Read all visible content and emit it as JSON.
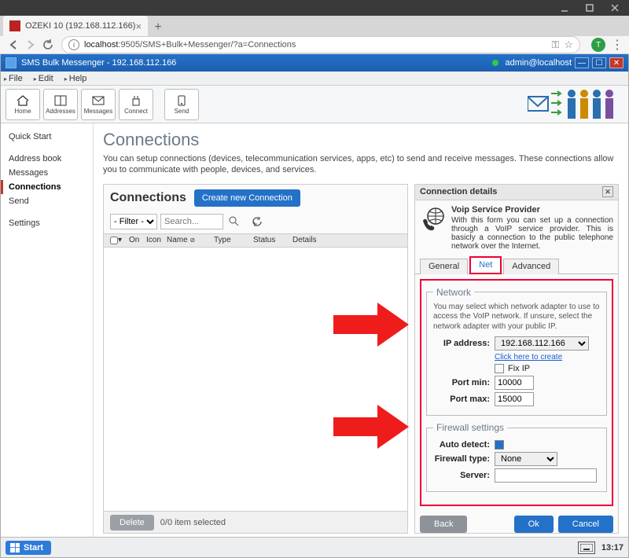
{
  "browser": {
    "tab_title": "OZEKI 10 (192.168.112.166)",
    "url_host": "localhost",
    "url_path": ":9505/SMS+Bulk+Messenger/?a=Connections",
    "avatar_letter": "T"
  },
  "app_bar": {
    "title": "SMS Bulk Messenger - 192.168.112.166",
    "user": "admin@localhost"
  },
  "menu": {
    "file": "File",
    "edit": "Edit",
    "help": "Help"
  },
  "toolbar": {
    "home": "Home",
    "addresses": "Addresses",
    "messages": "Messages",
    "connect": "Connect",
    "send": "Send"
  },
  "sidebar": {
    "quick_start": "Quick Start",
    "address_book": "Address book",
    "messages": "Messages",
    "connections": "Connections",
    "send": "Send",
    "settings": "Settings"
  },
  "main": {
    "heading": "Connections",
    "description": "You can setup connections (devices, telecommunication services, apps, etc) to send and receive messages. These connections allow you to communicate with people, devices, and services."
  },
  "conn_panel": {
    "title": "Connections",
    "create_btn": "Create new Connection",
    "filter_option": "- Filter -",
    "search_placeholder": "Search...",
    "cols": {
      "on": "On",
      "icon": "Icon",
      "name": "Name",
      "type": "Type",
      "status": "Status",
      "details": "Details"
    },
    "delete_btn": "Delete",
    "foot_status": "0/0 item selected"
  },
  "details": {
    "title": "Connection details",
    "provider_name": "Voip Service Provider",
    "provider_desc": "With this form you can set up a connection through a VoIP service provider. This is basicly a connection to the public telephone network over the Internet.",
    "tabs": {
      "general": "General",
      "net": "Net",
      "advanced": "Advanced"
    },
    "network": {
      "legend": "Network",
      "desc": "You may select which network adapter to use to access the VoIP network. If unsure, select the network adapter with your public IP.",
      "ip_label": "IP address:",
      "ip_value": "192.168.112.166",
      "create_link": "Click here to create",
      "fix_ip": "Fix IP",
      "port_min_label": "Port min:",
      "port_min_value": "10000",
      "port_max_label": "Port max:",
      "port_max_value": "15000"
    },
    "firewall": {
      "legend": "Firewall settings",
      "auto_label": "Auto detect:",
      "type_label": "Firewall type:",
      "type_value": "None",
      "server_label": "Server:",
      "server_value": ""
    },
    "buttons": {
      "back": "Back",
      "ok": "Ok",
      "cancel": "Cancel"
    }
  },
  "taskbar": {
    "start": "Start",
    "clock": "13:17"
  }
}
